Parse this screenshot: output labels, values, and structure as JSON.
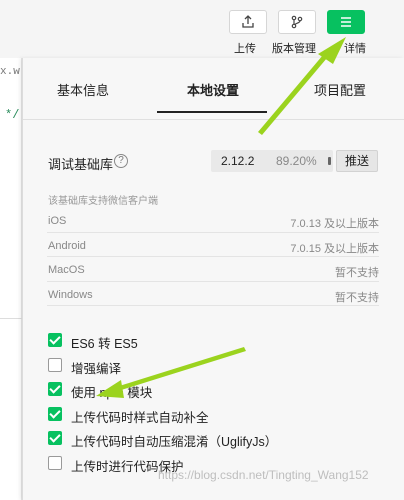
{
  "toolbar": {
    "upload_label": "上传",
    "version_label": "版本管理",
    "details_label": "详情"
  },
  "editor": {
    "tab_fragment": "x.w",
    "code_fragment": "*/"
  },
  "tabs": [
    {
      "label": "基本信息"
    },
    {
      "label": "本地设置"
    },
    {
      "label": "项目配置"
    }
  ],
  "lib": {
    "label": "调试基础库",
    "version": "2.12.2",
    "percent": "89.20%",
    "push_label": "推送",
    "help_symbol": "?"
  },
  "support_note": "该基础库支持微信客户端",
  "support": [
    {
      "os": "iOS",
      "status": "7.0.13 及以上版本"
    },
    {
      "os": "Android",
      "status": "7.0.15 及以上版本"
    },
    {
      "os": "MacOS",
      "status": "暂不支持"
    },
    {
      "os": "Windows",
      "status": "暂不支持"
    }
  ],
  "options": [
    {
      "label": "ES6 转 ES5",
      "checked": true
    },
    {
      "label": "增强编译",
      "checked": false
    },
    {
      "label": "使用 npm 模块",
      "checked": true
    },
    {
      "label": "上传代码时样式自动补全",
      "checked": true
    },
    {
      "label": "上传代码时自动压缩混淆（UglifyJs）",
      "checked": true
    },
    {
      "label": "上传时进行代码保护",
      "checked": false
    }
  ],
  "watermark": "https://blog.csdn.net/Tingting_Wang152",
  "colors": {
    "accent": "#07c160",
    "arrow": "#9bd31e"
  }
}
